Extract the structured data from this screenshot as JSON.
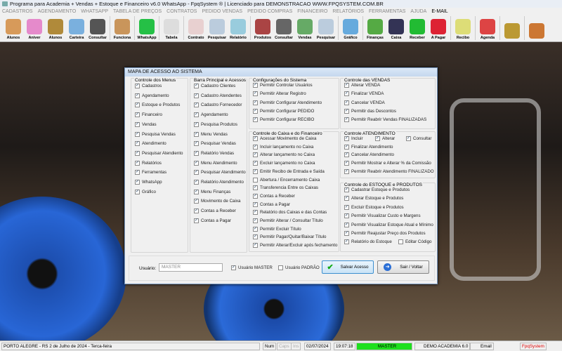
{
  "window": {
    "title": "Programa para Academia + Vendas + Estoque e Financeiro v6.0 WhatsApp - FpqSystem ® | Licenciado para  DEMONSTRACAO WWW.FPQSYSTEM.COM.BR"
  },
  "menu": [
    "CADASTROS",
    "AGENDAMENTO",
    "WHATSAPP",
    "TABELA DE PREÇOS",
    "CONTRATOS",
    "PEDIDO VENDAS",
    "PEDIDO COMPRAS",
    "FINANCEIRO",
    "RELATÓRIOS",
    "FERRAMENTAS",
    "AJUDA",
    "E-MAIL"
  ],
  "toolbar": [
    {
      "label": "Alunos",
      "color": "#d79a5a"
    },
    {
      "label": "Aniver",
      "color": "#e58acb"
    },
    {
      "label": "Alunos",
      "color": "#b08a3a"
    },
    {
      "label": "Carteira",
      "color": "#7ab0de"
    },
    {
      "label": "Consultar",
      "color": "#555"
    },
    {
      "sep": true
    },
    {
      "label": "Funciona",
      "color": "#c9955b"
    },
    {
      "sep": true
    },
    {
      "label": "WhatsApp",
      "color": "#25c046"
    },
    {
      "sep": true
    },
    {
      "label": "Tabela",
      "color": "#ddd"
    },
    {
      "sep": true
    },
    {
      "label": "Contrato",
      "color": "#e8d0d0"
    },
    {
      "label": "Pesquisar",
      "color": "#bcd"
    },
    {
      "label": "Relatório",
      "color": "#9cd"
    },
    {
      "sep": true
    },
    {
      "label": "Produtos",
      "color": "#a44"
    },
    {
      "label": "Consultar",
      "color": "#666"
    },
    {
      "label": "Vendas",
      "color": "#6a6"
    },
    {
      "label": "Pesquisar",
      "color": "#bcd"
    },
    {
      "sep": true
    },
    {
      "label": "Gráfico",
      "color": "#6ad"
    },
    {
      "sep": true
    },
    {
      "label": "Finanças",
      "color": "#5a4"
    },
    {
      "label": "Caixa",
      "color": "#335"
    },
    {
      "label": "Receber",
      "color": "#2b3"
    },
    {
      "label": "A Pagar",
      "color": "#d23"
    },
    {
      "sep": true
    },
    {
      "label": "Recibo",
      "color": "#dd7"
    },
    {
      "sep": true
    },
    {
      "label": "Agenda",
      "color": "#d44"
    },
    {
      "sep": true
    },
    {
      "label": "",
      "color": "#b93"
    },
    {
      "sep": true
    },
    {
      "label": "",
      "color": "#c73"
    }
  ],
  "dialog": {
    "title": "MAPA DE ACESSO AO SISTEMA",
    "groups": [
      {
        "title": "Controle dos Menus",
        "items": [
          [
            "Cadastros",
            1
          ],
          [
            "Agendamento",
            1
          ],
          [
            "Estoque e Produtos",
            1
          ],
          [
            "Financeiro",
            1
          ],
          [
            "Vendas",
            1
          ],
          [
            "Pesquisa Vendas",
            1
          ],
          [
            "Atendimento",
            1
          ],
          [
            "Pesquisar Atendiento",
            1
          ],
          [
            "Relatórios",
            1
          ],
          [
            "Ferramentas",
            1
          ],
          [
            "WhatsApp",
            1
          ],
          [
            "Gráfico",
            1
          ]
        ]
      },
      {
        "title": "Barra Principal e Acessos",
        "items": [
          [
            "Cadastro Clientes",
            1
          ],
          [
            "Cadastro Atendentes",
            1
          ],
          [
            "Cadastro Fornecedor",
            1
          ],
          [
            "Agendamento",
            1
          ],
          [
            "Pesquisa Produtos",
            1
          ],
          [
            "Menu Vendas",
            1
          ],
          [
            "Pesquisar Vendas",
            1
          ],
          [
            "Relatório Vendas",
            1
          ],
          [
            "Menu Atendimento",
            1
          ],
          [
            "Pesquisar Atendimento",
            1
          ],
          [
            "Relatório Atendimento",
            1
          ],
          [
            "Menu Finanças",
            1
          ],
          [
            "Movimento de Caixa",
            1
          ],
          [
            "Contas a Receber",
            1
          ],
          [
            "Contas a Pagar",
            1
          ]
        ]
      },
      {
        "title": "Configurações do Sistema",
        "items": [
          [
            "Permitir Controlar Usuários",
            1
          ],
          [
            "Permitir Alterar Registro",
            1
          ],
          [
            "Permitir Configurar Atendimento",
            1
          ],
          [
            "Permitir Configurar PEDIDO",
            1
          ],
          [
            "Permitir Configurar RECIBO",
            1
          ]
        ]
      },
      {
        "title": "Controle do Caixa e do Financeiro",
        "items": [
          [
            "Acessar Movimento de Caixa",
            1
          ],
          [
            "Incluir lançamento no Caixa",
            1
          ],
          [
            "Alterar lançamento no Caixa",
            1
          ],
          [
            "Excluir lançamento no Caixa",
            1
          ],
          [
            "Emitir Recibo de Entrada e Saída",
            1
          ],
          [
            "Abertura / Encerramento Caixa",
            0
          ],
          [
            "Transferencia Entre os Caixas",
            1
          ],
          [
            "Contas a Receber",
            1
          ],
          [
            "Contas a Pagar",
            1
          ],
          [
            "Relatório dos Caixas e das Contas",
            1
          ],
          [
            "Permitir Alterar / Consultar Título",
            1
          ],
          [
            "Permitir Excluir Título",
            1
          ],
          [
            "Permitir Pagar/Quitar/Baixar Título",
            1
          ],
          [
            "Permitir Alterar/Excluir após fechamento",
            1
          ]
        ]
      },
      {
        "title": "Controle das VENDAS",
        "items": [
          [
            "Alterar VENDA",
            1
          ],
          [
            "Finalizar VENDA",
            1
          ],
          [
            "Cancelar VENDA",
            1
          ],
          [
            "Permitir das Descontos",
            1
          ],
          [
            "Permitir Reabrir Vendas FINALIZADAS",
            1
          ]
        ]
      },
      {
        "title": "Controle ATENDIMENTO",
        "inline": [
          [
            "Incluir",
            1
          ],
          [
            "Alterar",
            1
          ],
          [
            "Consultar",
            1
          ]
        ],
        "items": [
          [
            "Finalizar Atendimento",
            1
          ],
          [
            "Cancelar Atendimento",
            1
          ],
          [
            "Permitir Mostrar e Alterar % da Comissão",
            1
          ],
          [
            "Permitir Reabrir Atendimento FINALIZADO",
            1
          ]
        ]
      },
      {
        "title": "Controle do ESTOQUE e PRODUTOS",
        "items": [
          [
            "Cadastrar Estoque e Produtos",
            1
          ],
          [
            "Alterar Estoque e Produtos",
            1
          ],
          [
            "Excluir Estoque e Produtos",
            1
          ],
          [
            "Permitir Visualizar Custo e Margens",
            1
          ],
          [
            "Permitir Visualizar Estoque Atual e Mínimo",
            1
          ],
          [
            "Permitir Reajustar Preço dos Produtos",
            1
          ],
          [
            "Relatório do Estoque",
            1
          ]
        ],
        "extra": [
          "Editar Código",
          0
        ]
      }
    ],
    "user_label": "Usuário:",
    "user_value": "MASTER",
    "master_label": "Usuário MASTER",
    "master_checked": true,
    "padrao_label": "Usuário PADRÃO",
    "padrao_checked": false,
    "save_label": "Salvar Acesso",
    "exit_label": "Sair / Voltar"
  },
  "status": {
    "location": "PORTO ALEGRE - RS  2 de Julho de 2024 - Terca-feira",
    "num": "Num",
    "caps": "Caps",
    "ins": "Ins",
    "date": "02/07/2024",
    "time": "19:07:18",
    "user": "MASTER",
    "company": "DEMO ACADEMIA 6.0",
    "email": "Email",
    "brand": "FpqSystem"
  }
}
